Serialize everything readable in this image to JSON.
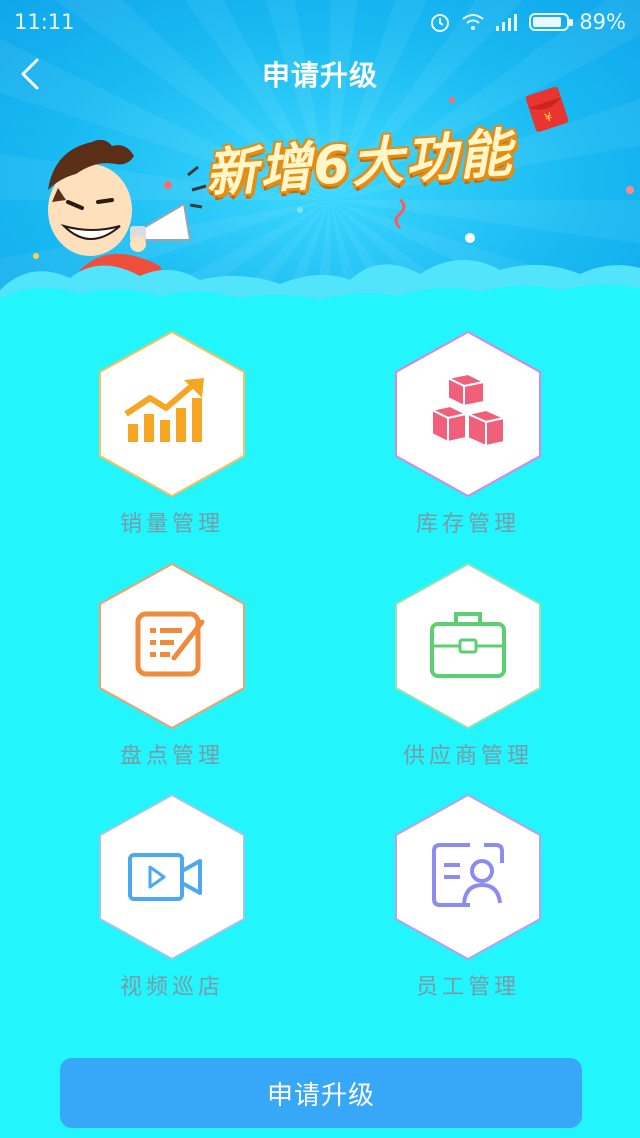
{
  "status_bar": {
    "time": "11:11",
    "battery_percent": "89%",
    "battery_level": 0.89
  },
  "nav": {
    "title": "申请升级",
    "back_icon": "chevron-left-icon"
  },
  "banner": {
    "headline": "新增6大功能"
  },
  "features": [
    {
      "label": "销量管理",
      "icon": "trend-chart-icon",
      "color": "#f5a623"
    },
    {
      "label": "库存管理",
      "icon": "boxes-icon",
      "color": "#f0607a"
    },
    {
      "label": "盘点管理",
      "icon": "edit-note-icon",
      "color": "#f08a3c"
    },
    {
      "label": "供应商管理",
      "icon": "briefcase-icon",
      "color": "#5ccf72"
    },
    {
      "label": "视频巡店",
      "icon": "video-camera-icon",
      "color": "#4ba9f2"
    },
    {
      "label": "员工管理",
      "icon": "employee-card-icon",
      "color": "#8b8cf0"
    }
  ],
  "apply_button": {
    "label": "申请升级"
  },
  "colors": {
    "background": "#22f5fb",
    "banner": "#18b9f2",
    "button": "#37a8f7"
  }
}
